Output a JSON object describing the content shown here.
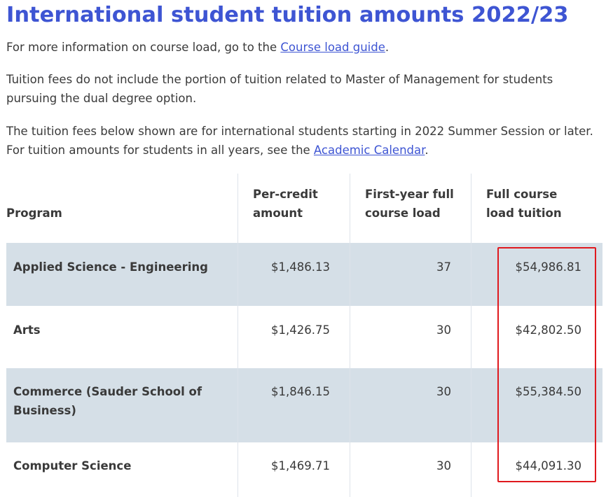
{
  "title": "International student tuition amounts 2022/23",
  "intro": {
    "line1_prefix": "For more information on course load, go to the ",
    "line1_link": "Course load guide",
    "line1_suffix": ".",
    "line2": "Tuition fees do not include the portion of tuition related to Master of Management for students pursuing the dual degree option.",
    "line3_prefix": "The tuition fees below shown are for international students starting in 2022 Summer Session or later. For tuition amounts for students in all years, see the ",
    "line3_link": "Academic Calendar",
    "line3_suffix": "."
  },
  "table": {
    "headers": {
      "program": "Program",
      "per_credit_1": "Per-credit",
      "per_credit_2": "amount",
      "first_year_1": "First-year full",
      "first_year_2": "course load",
      "full_course_1": "Full course",
      "full_course_2": "load tuition"
    },
    "rows": [
      {
        "program": "Applied Science - Engineering",
        "per_credit": "$1,486.13",
        "first_year_load": "37",
        "full_tuition": "$54,986.81"
      },
      {
        "program": "Arts",
        "per_credit": "$1,426.75",
        "first_year_load": "30",
        "full_tuition": "$42,802.50"
      },
      {
        "program": "Commerce (Sauder School of Business)",
        "per_credit": "$1,846.15",
        "first_year_load": "30",
        "full_tuition": "$55,384.50"
      },
      {
        "program": "Computer Science",
        "per_credit": "$1,469.71",
        "first_year_load": "30",
        "full_tuition": "$44,091.30"
      }
    ]
  },
  "colors": {
    "title": "#3e55d3",
    "link": "#3e55d3",
    "row_shade": "#d5dfe7",
    "highlight_border": "#e0191e"
  }
}
